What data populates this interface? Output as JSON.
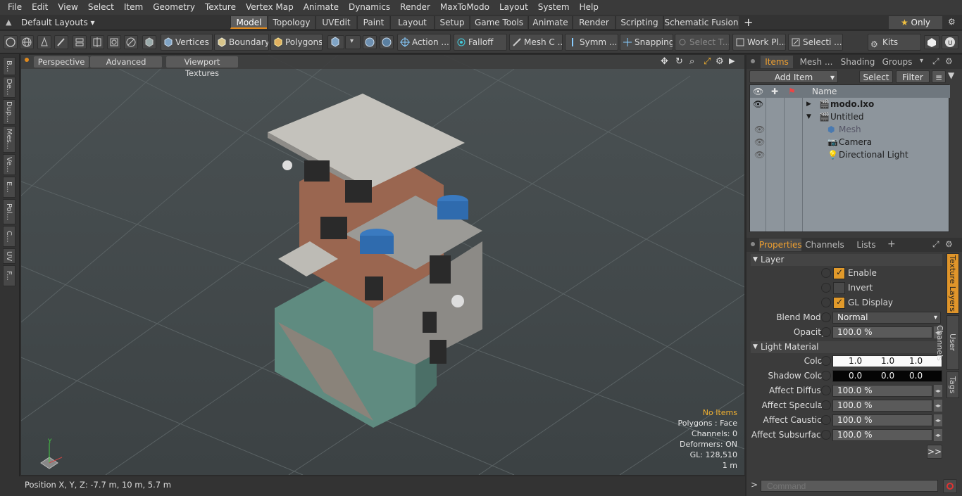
{
  "menu": [
    "File",
    "Edit",
    "View",
    "Select",
    "Item",
    "Geometry",
    "Texture",
    "Vertex Map",
    "Animate",
    "Dynamics",
    "Render",
    "MaxToModo",
    "Layout",
    "System",
    "Help"
  ],
  "layouts_label": "Default Layouts",
  "tabs": [
    "Model",
    "Topology",
    "UVEdit",
    "Paint",
    "Layout",
    "Setup",
    "Game Tools",
    "Animate",
    "Render",
    "Scripting",
    "Schematic Fusion"
  ],
  "only_label": "Only",
  "toolbar": {
    "vertices": "Vertices",
    "boundary": "Boundary",
    "polygons": "Polygons",
    "action": "Action",
    "falloff": "Falloff",
    "mesh": "Mesh C ...",
    "symm": "Symm ...",
    "snapping": "Snapping",
    "select_t": "Select T...",
    "work_pl": "Work Pl...",
    "selecti": "Selecti ...",
    "kits": "Kits"
  },
  "left_tabs": [
    "B...",
    "De...",
    "Dup...",
    "Mes...",
    "Ve...",
    "E...",
    "Pol...",
    "C...",
    "UV",
    "F..."
  ],
  "viewport": {
    "perspective": "Perspective",
    "advanced": "Advanced",
    "viewport_textures": "Viewport Textures",
    "info": {
      "no_items": "No Items",
      "polygons": "Polygons : Face",
      "channels": "Channels: 0",
      "deformers": "Deformers: ON",
      "gl": "GL: 128,510",
      "scale": "1 m"
    }
  },
  "status": "Position X, Y, Z:  -7.7 m, 10 m, 5.7 m",
  "items_panel": {
    "tabs": [
      "Items",
      "Mesh ...",
      "Shading",
      "Groups"
    ],
    "add_item": "Add Item",
    "select": "Select",
    "filter": "Filter",
    "name_header": "Name",
    "rows": [
      "modo.lxo",
      "Untitled",
      "Mesh",
      "Camera",
      "Directional Light"
    ]
  },
  "props_panel": {
    "tabs": [
      "Properties",
      "Channels",
      "Lists"
    ],
    "layer_section": "Layer",
    "enable": "Enable",
    "invert": "Invert",
    "gl_display": "GL Display",
    "blend_mode_label": "Blend Mode",
    "blend_mode_value": "Normal",
    "opacity_label": "Opacity",
    "opacity_value": "100.0 %",
    "light_material_section": "Light Material",
    "color_label": "Color",
    "color_values": [
      "1.0",
      "1.0",
      "1.0"
    ],
    "shadow_label": "Shadow Color",
    "shadow_values": [
      "0.0",
      "0.0",
      "0.0"
    ],
    "affect_diffuse_label": "Affect Diffuse",
    "affect_diffuse_value": "100.0 %",
    "affect_specular_label": "Affect Specular",
    "affect_specular_value": "100.0 %",
    "affect_caustics_label": "Affect Caustics",
    "affect_caustics_value": "100.0 %",
    "affect_subsurface_label": "Affect Subsurface",
    "affect_subsurface_value": "100.0 %",
    "more": ">>",
    "side_tabs": [
      "Texture Layers",
      "User Channels",
      "Tags"
    ]
  },
  "command_placeholder": "Command"
}
